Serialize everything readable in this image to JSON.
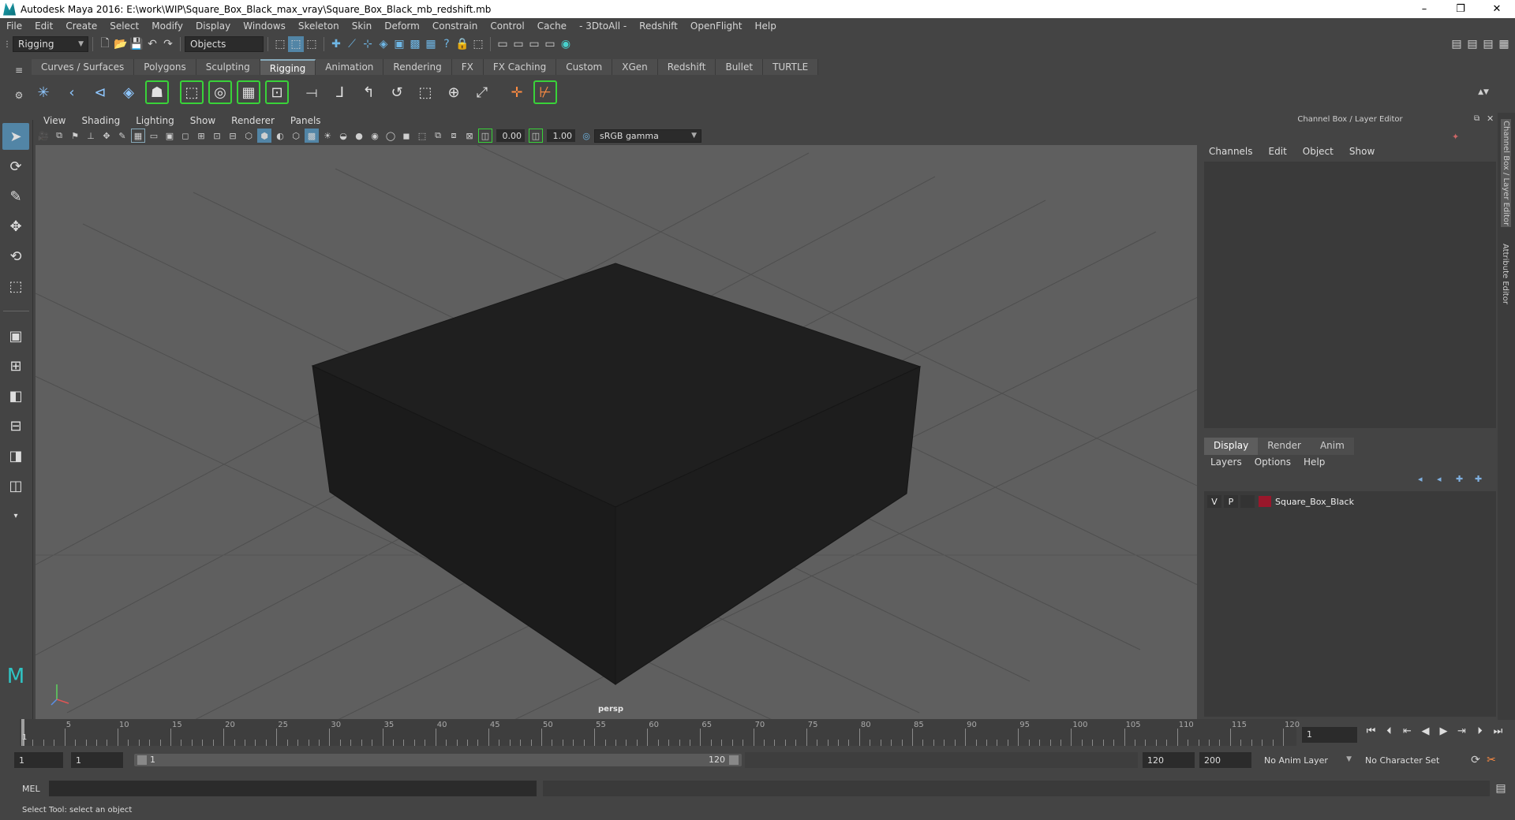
{
  "window": {
    "title": "Autodesk Maya 2016: E:\\work\\WIP\\Square_Box_Black_max_vray\\Square_Box_Black_mb_redshift.mb",
    "minimize": "–",
    "maximize": "❐",
    "close": "✕"
  },
  "menubar": [
    "File",
    "Edit",
    "Create",
    "Select",
    "Modify",
    "Display",
    "Windows",
    "Skeleton",
    "Skin",
    "Deform",
    "Constrain",
    "Control",
    "Cache",
    "- 3DtoAll -",
    "Redshift",
    "OpenFlight",
    "Help"
  ],
  "statusline": {
    "menuset": "Rigging",
    "selection_mask": "Objects"
  },
  "shelf": {
    "tabs": [
      "Curves / Surfaces",
      "Polygons",
      "Sculpting",
      "Rigging",
      "Animation",
      "Rendering",
      "FX",
      "FX Caching",
      "Custom",
      "XGen",
      "Redshift",
      "Bullet",
      "TURTLE"
    ],
    "active_tab": "Rigging"
  },
  "viewport": {
    "menu": [
      "View",
      "Shading",
      "Lighting",
      "Show",
      "Renderer",
      "Panels"
    ],
    "exposure": "0.00",
    "gamma": "1.00",
    "color_space": "sRGB gamma",
    "camera_label": "persp"
  },
  "channel_box": {
    "title": "Channel Box / Layer Editor",
    "menu": [
      "Channels",
      "Edit",
      "Object",
      "Show"
    ],
    "layer_tabs": [
      "Display",
      "Render",
      "Anim"
    ],
    "active_layer_tab": "Display",
    "layer_menu": [
      "Layers",
      "Options",
      "Help"
    ],
    "layers": [
      {
        "visible": "V",
        "playback": "P",
        "name": "Square_Box_Black",
        "color": "#99172b"
      }
    ],
    "side_tab_1": "Channel Box / Layer Editor",
    "side_tab_2": "Attribute Editor"
  },
  "timeline": {
    "ticks": [
      "5",
      "10",
      "15",
      "20",
      "25",
      "30",
      "35",
      "40",
      "45",
      "50",
      "55",
      "60",
      "65",
      "70",
      "75",
      "80",
      "85",
      "90",
      "95",
      "100",
      "105",
      "110",
      "115",
      "120"
    ],
    "first_tick": "1",
    "current_frame": "1"
  },
  "range": {
    "start_time": "1",
    "playback_start": "1",
    "slider_start": "1",
    "slider_end": "120",
    "playback_end": "120",
    "end_time": "200",
    "anim_layer": "No Anim Layer",
    "character_set": "No Character Set"
  },
  "command_line": {
    "label": "MEL"
  },
  "help_line": "Select Tool: select an object",
  "colors": {
    "background": "#444444",
    "viewport_bg": "#5f5f5f",
    "box": "#1c1c1c",
    "accent": "#5285a6",
    "layer_color": "#99172b"
  }
}
